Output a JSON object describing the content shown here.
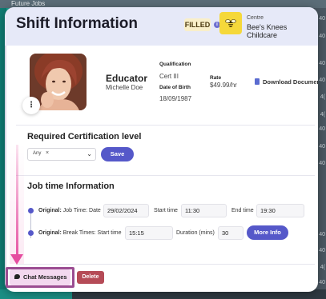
{
  "background": {
    "tab_label": "Future Jobs",
    "right_rows": [
      "40",
      "40",
      "40",
      "40",
      "4(",
      "4(",
      "40",
      "40",
      "40",
      "40",
      "40",
      "4(",
      "40"
    ]
  },
  "modal": {
    "title": "Shift Information",
    "status_badge": "FILLED",
    "info_icon": "i",
    "centre": {
      "label": "Centre",
      "name": "Bee's Knees Childcare",
      "logo_icon": "bee-icon"
    }
  },
  "profile": {
    "role": "Educator",
    "name": "Michelle Doe",
    "qualification_label": "Qualification",
    "qualification": "Cert III",
    "dob_label": "Date of Birth",
    "dob": "18/09/1987",
    "rate_label": "Rate",
    "rate": "$49.99/hr",
    "download_label": "Download Document",
    "more_icon": "⋮"
  },
  "certification": {
    "title": "Required Certification level",
    "selected_chip": "Any",
    "chip_remove": "×",
    "chevron": "⌄",
    "save_label": "Save"
  },
  "job_time": {
    "title": "Job time Information",
    "row1": {
      "prefix": "Original:",
      "text": "Job Time: Date",
      "date": "29/02/2024",
      "start_label": "Start time",
      "start": "11:30",
      "end_label": "End time",
      "end": "19:30"
    },
    "row2": {
      "prefix": "Original:",
      "text": "Break Times: Start time",
      "start": "15:15",
      "duration_label": "Duration (mins)",
      "duration": "30",
      "more_label": "More Info"
    }
  },
  "footer": {
    "chat_label": "Chat Messages",
    "delete_label": "Delete"
  },
  "colors": {
    "accent": "#5558c9",
    "filled_badge": "#f9efc9",
    "delete": "#b54b57",
    "chat_bg": "#f3d8ef",
    "annotation": "#e54ea0"
  }
}
